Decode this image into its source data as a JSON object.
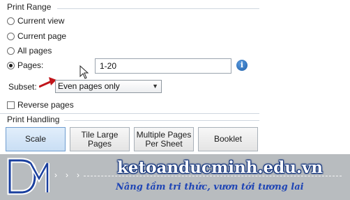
{
  "print_range": {
    "title": "Print Range",
    "options": [
      {
        "label": "Current view",
        "checked": false
      },
      {
        "label": "Current page",
        "checked": false
      },
      {
        "label": "All pages",
        "checked": false
      },
      {
        "label": "Pages:",
        "checked": true
      }
    ],
    "pages_value": "1-20",
    "info_icon": "info-icon",
    "subset_label": "Subset:",
    "subset_selected": "Even pages only",
    "reverse_label": "Reverse pages",
    "reverse_checked": false
  },
  "print_handling": {
    "title": "Print Handling",
    "buttons": [
      {
        "label": "Scale",
        "selected": true
      },
      {
        "label": "Tile Large\nPages",
        "selected": false
      },
      {
        "label": "Multiple Pages\nPer Sheet",
        "selected": false
      },
      {
        "label": "Booklet",
        "selected": false
      }
    ]
  },
  "banner": {
    "site": "ketoanducminh.edu.vn",
    "slogan": "Nâng tầm tri thức, vươn tới tương lai",
    "logo_icon": "dm-logo-icon",
    "colors": {
      "background": "#b8bcbf",
      "site_outline": "#0d2f7a",
      "slogan": "#1f45b5",
      "logo": "#1a3f9e"
    }
  },
  "colors": {
    "annotation_arrow": "#c0151b",
    "selected_button": "#c9def4"
  }
}
